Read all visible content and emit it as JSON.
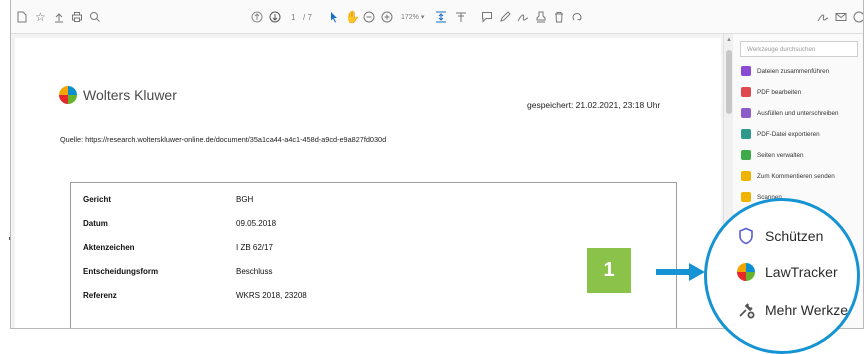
{
  "toolbar": {
    "page_current": "1",
    "page_total": "/ 7",
    "zoom": "172%",
    "tools": [
      "file-icon",
      "star-icon",
      "upload-icon",
      "print-icon",
      "search-icon",
      "page-up-icon",
      "page-down-icon",
      "select-cursor-icon",
      "hand-icon",
      "zoom-out-icon",
      "zoom-in-icon",
      "fit-page-icon",
      "scroll-mode-icon",
      "comment-icon",
      "pen-icon",
      "sign-icon",
      "stamp-icon",
      "delete-icon",
      "undo-icon",
      "share-link-icon",
      "email-icon"
    ]
  },
  "document": {
    "logo_text": "Wolters Kluwer",
    "saved": "gespeichert: 21.02.2021, 23:18 Uhr",
    "source": "Quelle: https://research.wolterskluwer-online.de/document/35a1ca44-a4c1-458d-a9cd-e9a827fd030d",
    "rows": [
      {
        "key": "Gericht",
        "value": "BGH"
      },
      {
        "key": "Datum",
        "value": "09.05.2018"
      },
      {
        "key": "Aktenzeichen",
        "value": "I ZB 62/17"
      },
      {
        "key": "Entscheidungsform",
        "value": "Beschluss"
      },
      {
        "key": "Referenz",
        "value": "WKRS 2018, 23208"
      }
    ]
  },
  "tools_pane": {
    "search_placeholder": "Werkzeuge durchsuchen",
    "items": [
      {
        "label": "Dateien zusammenführen",
        "color": "#8a4ad3"
      },
      {
        "label": "PDF bearbeiten",
        "color": "#e0484f"
      },
      {
        "label": "Ausfüllen und unterschreiben",
        "color": "#8e5cc9"
      },
      {
        "label": "PDF-Datei exportieren",
        "color": "#2f9a8c"
      },
      {
        "label": "Seiten verwalten",
        "color": "#3dab4a"
      },
      {
        "label": "Zum Kommentieren senden",
        "color": "#f0b400"
      },
      {
        "label": "Scannen",
        "color": "#f0b400"
      }
    ]
  },
  "magnifier": {
    "items": [
      {
        "label": "Schützen",
        "icon": "shield-icon"
      },
      {
        "label": "LawTracker",
        "icon": "lawtracker-icon"
      },
      {
        "label": "Mehr Werkze",
        "icon": "more-tools-icon"
      }
    ]
  },
  "callout": {
    "number": "1",
    "color": "#8bc34a"
  },
  "colors": {
    "accent": "#1593d2"
  }
}
